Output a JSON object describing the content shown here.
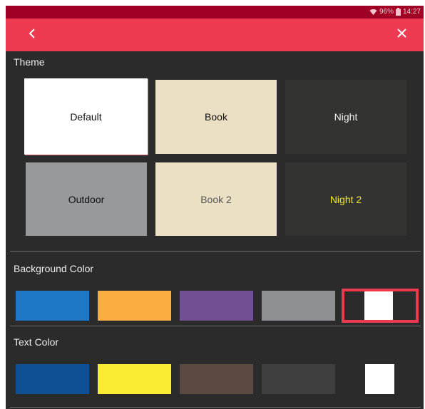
{
  "status": {
    "battery": "96%",
    "time": "14:27",
    "icons": [
      "wifi-icon",
      "battery-icon"
    ]
  },
  "toolbar": {
    "back_icon": "chevron-left-icon",
    "close_icon": "close-icon",
    "background": "#ee3a50"
  },
  "theme": {
    "title": "Theme",
    "cards": [
      {
        "label": "Default",
        "bg": "#ffffff",
        "fg": "#111111"
      },
      {
        "label": "Book",
        "bg": "#ece0c4",
        "fg": "#111111"
      },
      {
        "label": "Night",
        "bg": "#333431",
        "fg": "#f0f0f0"
      },
      {
        "label": "Outdoor",
        "bg": "#98999b",
        "fg": "#111111"
      },
      {
        "label": "Book 2",
        "bg": "#ece0c4",
        "fg": "#555555"
      },
      {
        "label": "Night 2",
        "bg": "#333431",
        "fg": "#f0e62e"
      }
    ]
  },
  "background_color": {
    "title": "Background Color",
    "swatches": [
      "#1f78c6",
      "#fbad42",
      "#724f92",
      "#8f9093",
      "#ffffff"
    ],
    "selected": "#ffffff"
  },
  "text_color": {
    "title": "Text Color",
    "swatches": [
      "#0f4f94",
      "#f9ec33",
      "#5a4a41",
      "#3f3f40",
      "#ffffff"
    ]
  }
}
